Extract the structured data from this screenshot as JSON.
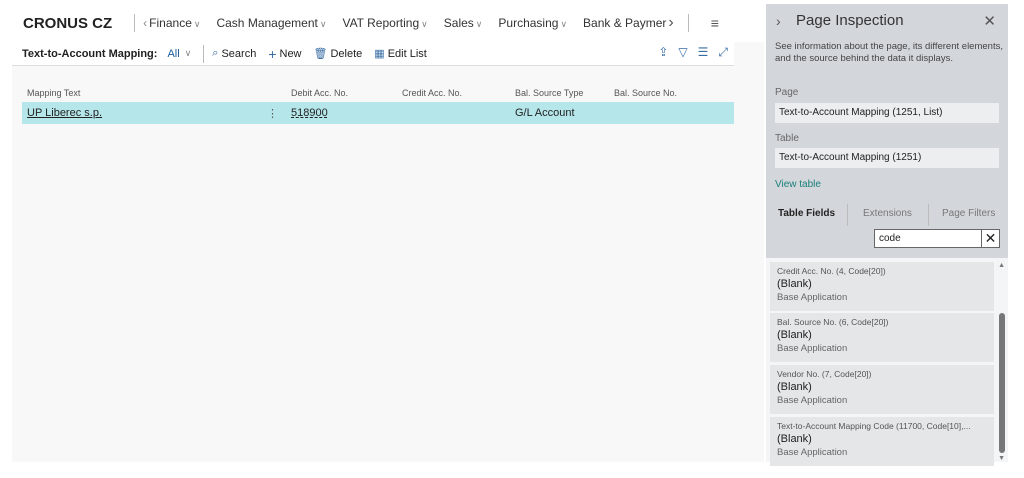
{
  "nav": {
    "brand": "CRONUS CZ",
    "items": [
      "Finance",
      "Cash Management",
      "VAT Reporting",
      "Sales",
      "Purchasing",
      "Bank & Paymer"
    ]
  },
  "actionbar": {
    "title": "Text-to-Account Mapping:",
    "filter": "All",
    "search": "Search",
    "new": "New",
    "delete": "Delete",
    "edit_list": "Edit List"
  },
  "grid": {
    "headers": [
      "Mapping Text",
      "Debit Acc. No.",
      "Credit Acc. No.",
      "Bal. Source Type",
      "Bal. Source No."
    ],
    "rows": [
      {
        "mapping_text": "UP Liberec s.p.",
        "debit": "518900",
        "credit": "",
        "bal_type": "G/L Account",
        "bal_no": ""
      }
    ]
  },
  "inspection": {
    "title": "Page Inspection",
    "description": "See information about the page, its different elements, and the source behind the data it displays.",
    "page_label": "Page",
    "page_value": "Text-to-Account Mapping (1251, List)",
    "table_label": "Table",
    "table_value": "Text-to-Account Mapping (1251)",
    "view_table": "View table",
    "tabs": [
      "Table Fields",
      "Extensions",
      "Page Filters"
    ],
    "search_value": "code",
    "fields": [
      {
        "name": "Credit Acc. No. (4, Code[20])",
        "value": "(Blank)",
        "source": "Base Application"
      },
      {
        "name": "Bal. Source No. (6, Code[20])",
        "value": "(Blank)",
        "source": "Base Application"
      },
      {
        "name": "Vendor No. (7, Code[20])",
        "value": "(Blank)",
        "source": "Base Application"
      },
      {
        "name": "Text-to-Account Mapping Code (11700, Code[10],...",
        "value": "(Blank)",
        "source": "Base Application"
      }
    ]
  },
  "colors": {
    "selected_row": "#b5e6ea",
    "panel": "#d3d7dc",
    "link": "#1a7f7a"
  }
}
